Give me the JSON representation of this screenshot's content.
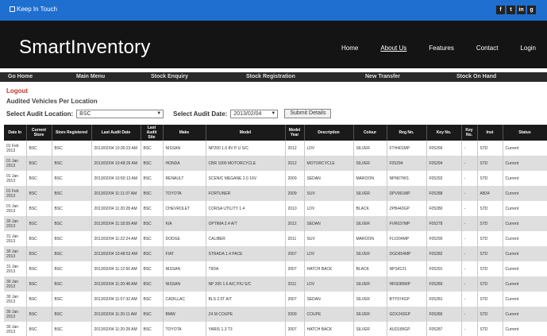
{
  "topbar": {
    "keep_in_touch": "Keep In Touch",
    "social": [
      "f",
      "t",
      "in",
      "g"
    ]
  },
  "header": {
    "brand": "SmartInventory",
    "nav": [
      "Home",
      "About Us",
      "Features",
      "Contact",
      "Login"
    ],
    "active_nav": "About Us"
  },
  "menubar": [
    "Go Home",
    "Main Menu",
    "Stock Enquiry",
    "Stock Registration",
    "New Transfer",
    "Stock On Hand"
  ],
  "logout": "Logout",
  "audited_heading": "Audited Vehicles Per Location",
  "filters": {
    "location_label": "Select Audit Location:",
    "location_value": "BSC",
    "date_label": "Select Audit Date:",
    "date_value": "2013/02/04",
    "submit_label": "Submit Details"
  },
  "table": {
    "columns": [
      "Date In",
      "Current Store",
      "Store Registered",
      "Last Audit Date",
      "Last Audit Site",
      "Make",
      "Model",
      "Model Year",
      "Description",
      "Colour",
      "Reg No.",
      "Key No.",
      "Key No.",
      "Inst",
      "Status"
    ],
    "rows": [
      [
        "01 Feb 2013",
        "BSC",
        "BSC",
        "2013/02/04 10:30:23 AM",
        "BSC",
        "NISSAN",
        "NP200 1.6 8V P U S/C",
        "2012",
        "LDV",
        "SILVER",
        "FTH401MP",
        "F05266",
        "-",
        "STD",
        "Current"
      ],
      [
        "01 Jan 2013",
        "BSC",
        "BSC",
        "2013/02/04 10:48:26 AM",
        "BSC",
        "HONDA",
        "CBR 1000 MOTORCYCLE",
        "2012",
        "MOTORCYCLE",
        "SILVER",
        "F05294",
        "F05294",
        "-",
        "STD",
        "Current"
      ],
      [
        "01 Jan 2013",
        "BSC",
        "BSC",
        "2013/02/04 10:50:13 AM",
        "BSC",
        "RENAULT",
        "SCENIC MEGANE 2.0 16V",
        "2009",
        "SEDAN",
        "MAROON",
        "NPN07WS",
        "F05292",
        "-",
        "STD",
        "Current"
      ],
      [
        "01 Feb 2013",
        "BSC",
        "BSC",
        "2013/02/04 11:11:37 AM",
        "BSC",
        "TOYOTA",
        "FORTUNER",
        "2009",
        "SUV",
        "SILVER",
        "DPV061MP",
        "F05288",
        "-",
        "AB34",
        "Current"
      ],
      [
        "01 Jan 2013",
        "BSC",
        "BSC",
        "2013/02/04 11:20:28 AM",
        "BSC",
        "CHEVROLET",
        "CORSA UTILITY 1.4",
        "2010",
        "LDV",
        "BLACK",
        "ZPB443GP",
        "F05280",
        "-",
        "STD",
        "Current"
      ],
      [
        "30 Jan 2013",
        "BSC",
        "BSC",
        "2013/02/04 11:18:59 AM",
        "BSC",
        "KIA",
        "OPTIMA 2.4 A/T",
        "2012",
        "SEDAN",
        "SILVER",
        "FVR037MP",
        "F05278",
        "-",
        "STD",
        "Current"
      ],
      [
        "31 Jan 2013",
        "BSC",
        "BSC",
        "2013/02/04 11:22:24 AM",
        "BSC",
        "DODGE",
        "CALIBER",
        "2011",
        "SUV",
        "MAROON",
        "FLV204MP",
        "F05290",
        "-",
        "STD",
        "Current"
      ],
      [
        "30 Jan 2013",
        "BSC",
        "BSC",
        "2013/02/04 10:48:52 AM",
        "BSC",
        "FIAT",
        "STRADA 1.4 PACE",
        "2007",
        "LDV",
        "SILVER",
        "DGD654MP",
        "F05282",
        "-",
        "STD",
        "Current"
      ],
      [
        "31 Jan 2013",
        "BSC",
        "BSC",
        "2013/02/04 11:12:56 AM",
        "BSC",
        "NISSAN",
        "TIIDA",
        "2007",
        "HATCH BACK",
        "BLACK",
        "NPS4121",
        "F05291",
        "-",
        "STD",
        "Current"
      ],
      [
        "30 Jan 2013",
        "BSC",
        "BSC",
        "2013/02/04 11:20:48 AM",
        "BSC",
        "NISSAN",
        "NP 200 1.6 A/C P/U S/C",
        "2011",
        "LDV",
        "SILVER",
        "HRS080MP",
        "F05289",
        "-",
        "STD",
        "Current"
      ],
      [
        "30 Jan 2013",
        "BSC",
        "BSC",
        "2013/02/04 11:07:32 AM",
        "BSC",
        "CADILLAC",
        "BLS 2.0T A/T",
        "2007",
        "SEDAN",
        "SILVER",
        "BTY974GP",
        "F05281",
        "-",
        "STD",
        "Current"
      ],
      [
        "30 Jan 2013",
        "BSC",
        "BSC",
        "2013/02/04 11:20:11 AM",
        "BSC",
        "BMW",
        "Z4 M COUPE",
        "2009",
        "COUPE",
        "SILVER",
        "GDX243GP",
        "F05286",
        "-",
        "STD",
        "Current"
      ],
      [
        "30 Jan 2013",
        "BSC",
        "BSC",
        "2013/02/04 11:20:28 AM",
        "BSC",
        "TOYOTA",
        "YARIS 1.3 T3",
        "2007",
        "HATCH BACK",
        "SILVER",
        "AUD185GP",
        "F05287",
        "-",
        "STD",
        "Current"
      ]
    ]
  },
  "colors": {
    "topbar": "#1e6fcf",
    "header": "#141414",
    "menubar": "#2a2a2a",
    "logout": "#c0392b",
    "row_alt": "#dedede"
  }
}
